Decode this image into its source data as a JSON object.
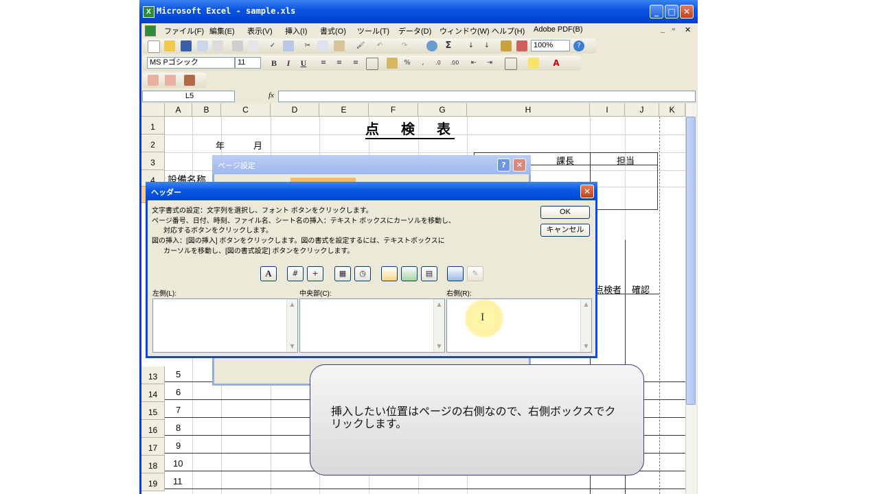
{
  "window": {
    "title": "Microsoft Excel - sample.xls"
  },
  "menu": [
    "ファイル(F)",
    "編集(E)",
    "表示(V)",
    "挿入(I)",
    "書式(O)",
    "ツール(T)",
    "データ(D)",
    "ウィンドウ(W)",
    "ヘルプ(H)",
    "Adobe PDF(B)"
  ],
  "toolbar": {
    "zoom": "100%",
    "font": "MS Pゴシック",
    "size": "11"
  },
  "namebox": "L5",
  "columns": [
    "A",
    "B",
    "C",
    "D",
    "E",
    "F",
    "G",
    "H",
    "I",
    "J",
    "K"
  ],
  "rows": [
    "1",
    "2",
    "3",
    "4",
    "5",
    "13",
    "14",
    "15",
    "16",
    "17",
    "18",
    "19"
  ],
  "cells": {
    "title": "点　検　表",
    "year": "年",
    "month": "月",
    "kacho": "課長",
    "tanto": "担当",
    "setsubi": "設備名称",
    "tenkensha": "点検者",
    "kakunin": "確認",
    "nums": [
      "5",
      "6",
      "7",
      "8",
      "9",
      "10",
      "11"
    ]
  },
  "page_setup": {
    "title": "ページ設定"
  },
  "header_dialog": {
    "title": "ヘッダー",
    "instructions": [
      "文字書式の設定：文字列を選択し、フォント ボタンをクリックします。",
      "ページ番号、日付、時刻、ファイル名、シート名の挿入：テキスト ボックスにカーソルを移動し、",
      "対応するボタンをクリックします。",
      "図の挿入：[図の挿入] ボタンをクリックします。図の書式を設定するには、テキストボックスに",
      "カーソルを移動し、[図の書式設定] ボタンをクリックします。"
    ],
    "ok": "OK",
    "cancel": "キャンセル",
    "left_label": "左側(L):",
    "center_label": "中央部(C):",
    "right_label": "右側(R):"
  },
  "callout": "挿入したい位置はページの右側なので、右側ボックスでクリックします。"
}
